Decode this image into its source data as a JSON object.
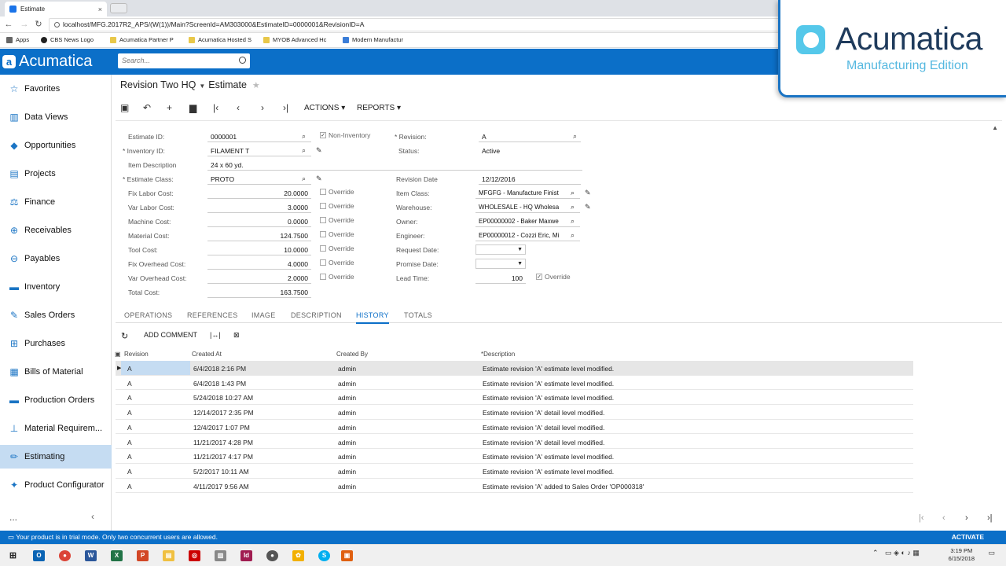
{
  "browser": {
    "tab_title": "Estimate",
    "url": "localhost/MFG.2017R2_APS/(W(1))/Main?ScreenId=AM303000&EstimateID=0000001&RevisionID=A",
    "bookmarks": [
      "Apps",
      "CBS News Logo",
      "Acumatica Partner P",
      "Acumatica Hosted S",
      "MYOB Advanced Hc",
      "Modern Manufactur"
    ]
  },
  "app": {
    "logo": "Acumatica",
    "search_placeholder": "Search..."
  },
  "sidebar": {
    "items": [
      {
        "label": "Favorites",
        "icon": "star-icon"
      },
      {
        "label": "Data Views",
        "icon": "chart-icon"
      },
      {
        "label": "Opportunities",
        "icon": "tag-icon"
      },
      {
        "label": "Projects",
        "icon": "folder-icon"
      },
      {
        "label": "Finance",
        "icon": "scales-icon"
      },
      {
        "label": "Receivables",
        "icon": "plus-circle-icon"
      },
      {
        "label": "Payables",
        "icon": "minus-circle-icon"
      },
      {
        "label": "Inventory",
        "icon": "truck-icon"
      },
      {
        "label": "Sales Orders",
        "icon": "pencil-doc-icon"
      },
      {
        "label": "Purchases",
        "icon": "cart-icon"
      },
      {
        "label": "Bills of Material",
        "icon": "book-icon"
      },
      {
        "label": "Production Orders",
        "icon": "truck-icon"
      },
      {
        "label": "Material Requirem...",
        "icon": "forklift-icon"
      },
      {
        "label": "Estimating",
        "icon": "pencil-icon"
      },
      {
        "label": "Product Configurator",
        "icon": "wrench-icon"
      }
    ],
    "more": "...",
    "collapse": "‹"
  },
  "page": {
    "title": "Revision Two HQ",
    "screen": "Estimate",
    "actions_label": "ACTIONS",
    "reports_label": "REPORTS"
  },
  "form": {
    "estimate_id_label": "Estimate ID:",
    "estimate_id": "0000001",
    "non_inventory_label": "Non-Inventory",
    "revision_label": "Revision:",
    "revision": "A",
    "inventory_id_label": "Inventory ID:",
    "inventory_id": "FILAMENT T",
    "status_label": "Status:",
    "status": "Active",
    "item_desc_label": "Item Description",
    "item_desc": "24 x 60 yd.",
    "estimate_class_label": "Estimate Class:",
    "estimate_class": "PROTO",
    "revision_date_label": "Revision Date",
    "revision_date": "12/12/2016",
    "costs": [
      {
        "label": "Fix Labor Cost:",
        "value": "20.0000",
        "override": "Override"
      },
      {
        "label": "Var Labor Cost:",
        "value": "3.0000",
        "override": "Override"
      },
      {
        "label": "Machine Cost:",
        "value": "0.0000",
        "override": "Override"
      },
      {
        "label": "Material Cost:",
        "value": "124.7500",
        "override": "Override"
      },
      {
        "label": "Tool Cost:",
        "value": "10.0000",
        "override": "Override"
      },
      {
        "label": "Fix Overhead Cost:",
        "value": "4.0000",
        "override": "Override"
      },
      {
        "label": "Var Overhead Cost:",
        "value": "2.0000",
        "override": "Override"
      },
      {
        "label": "Total Cost:",
        "value": "163.7500"
      }
    ],
    "right_fields": [
      {
        "label": "Item Class:",
        "value": "MFGFG - Manufacture Finist"
      },
      {
        "label": "Warehouse:",
        "value": "WHOLESALE - HQ Wholesa"
      },
      {
        "label": "Owner:",
        "value": "EP00000002 - Baker Maxwe"
      },
      {
        "label": "Engineer:",
        "value": "EP00000012 - Cozzi Eric, Mi"
      }
    ],
    "request_date_label": "Request Date:",
    "promise_date_label": "Promise Date:",
    "lead_time_label": "Lead Time:",
    "lead_time": "100",
    "lead_override": "Override"
  },
  "tabs": [
    "OPERATIONS",
    "REFERENCES",
    "IMAGE",
    "DESCRIPTION",
    "HISTORY",
    "TOTALS"
  ],
  "history": {
    "add_comment": "ADD COMMENT",
    "columns": [
      "Revision",
      "Created At",
      "Created By",
      "Description"
    ],
    "rows": [
      {
        "rev": "A",
        "at": "6/4/2018 2:16 PM",
        "by": "admin",
        "desc": "Estimate revision 'A' estimate level modified."
      },
      {
        "rev": "A",
        "at": "6/4/2018 1:43 PM",
        "by": "admin",
        "desc": "Estimate revision 'A' estimate level modified."
      },
      {
        "rev": "A",
        "at": "5/24/2018 10:27 AM",
        "by": "admin",
        "desc": "Estimate revision 'A' estimate level modified."
      },
      {
        "rev": "A",
        "at": "12/14/2017 2:35 PM",
        "by": "admin",
        "desc": "Estimate revision 'A' detail level modified."
      },
      {
        "rev": "A",
        "at": "12/4/2017 1:07 PM",
        "by": "admin",
        "desc": "Estimate revision 'A' detail level modified."
      },
      {
        "rev": "A",
        "at": "11/21/2017 4:28 PM",
        "by": "admin",
        "desc": "Estimate revision 'A' detail level modified."
      },
      {
        "rev": "A",
        "at": "11/21/2017 4:17 PM",
        "by": "admin",
        "desc": "Estimate revision 'A' estimate level modified."
      },
      {
        "rev": "A",
        "at": "5/2/2017 10:11 AM",
        "by": "admin",
        "desc": "Estimate revision 'A' estimate level modified."
      },
      {
        "rev": "A",
        "at": "4/11/2017 9:56 AM",
        "by": "admin",
        "desc": "Estimate revision 'A' added to Sales Order 'OP000318'"
      }
    ]
  },
  "status_bar": {
    "message": "Your product is in trial mode. Only two concurrent users are allowed.",
    "activate": "ACTIVATE"
  },
  "taskbar": {
    "time": "3:19 PM",
    "date": "6/15/2018"
  },
  "overlay": {
    "name": "Acumatica",
    "edition": "Manufacturing Edition"
  },
  "colors": {
    "brand": "#0b6fc8",
    "selection": "#c5dcf2"
  }
}
